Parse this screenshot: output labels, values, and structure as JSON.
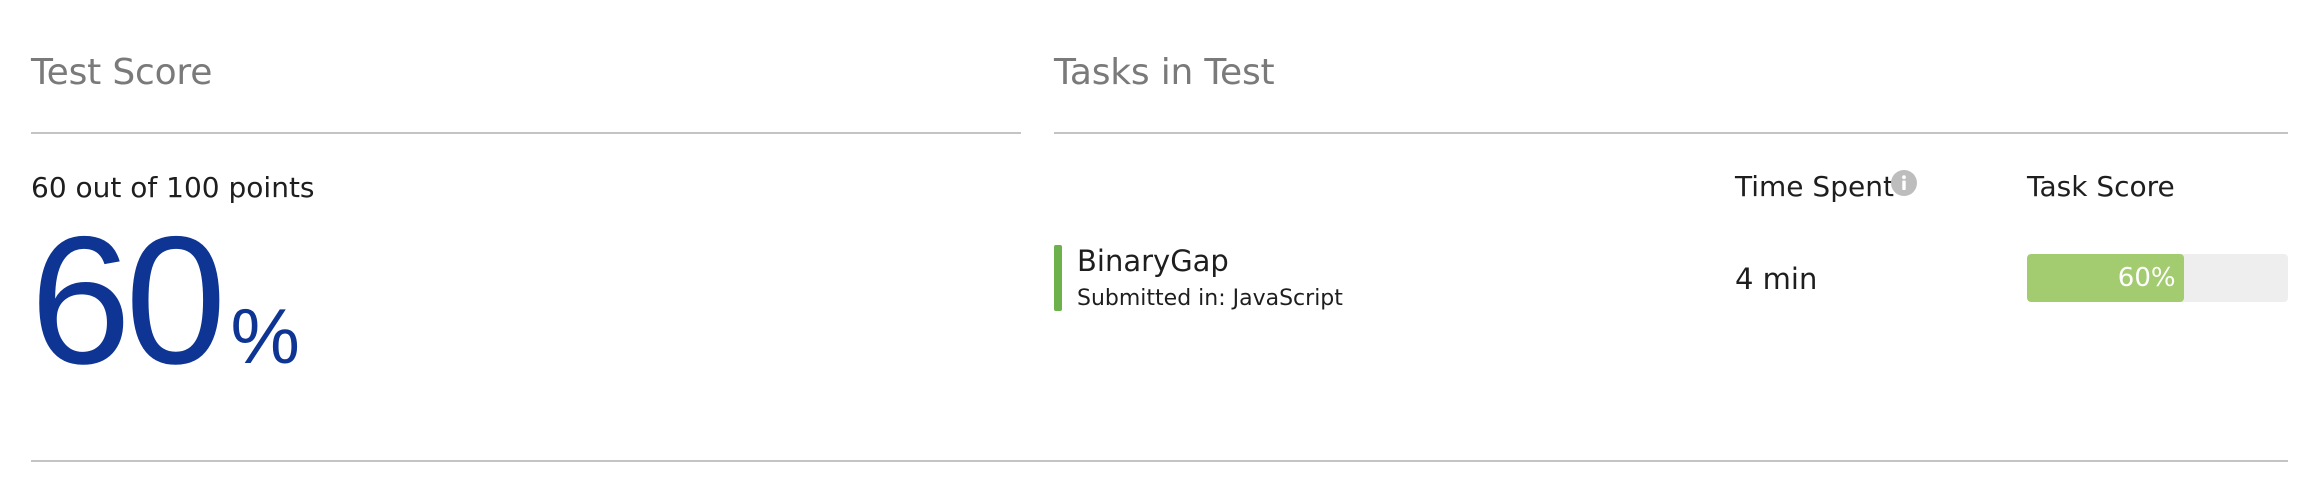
{
  "test_score": {
    "title": "Test Score",
    "points_text": "60 out of 100 points",
    "percent_value": "60",
    "percent_sign": "%"
  },
  "tasks": {
    "title": "Tasks in Test",
    "columns": {
      "time_spent": "Time Spent",
      "task_score": "Task Score"
    },
    "info_icon": "info-icon",
    "items": [
      {
        "name": "BinaryGap",
        "submitted": "Submitted in: JavaScript",
        "time": "4 min",
        "score_label": "60%",
        "score_fraction": 0.6,
        "status_color": "#6cb14c"
      }
    ]
  },
  "colors": {
    "score_blue": "#0e3593",
    "title_gray": "#7a7a7a",
    "rule_gray": "#c4c4c4",
    "progress_fill": "#a3cc70",
    "progress_track": "#eeeeee",
    "info_icon_gray": "#bdbdbd"
  }
}
